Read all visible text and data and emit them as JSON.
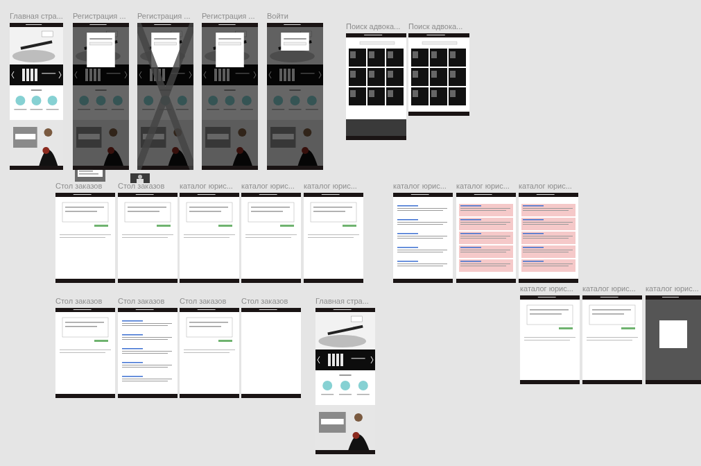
{
  "frames": [
    {
      "title": "Главная стра...",
      "kind": "home",
      "crossed": false
    },
    {
      "title": "Регистрация ...",
      "kind": "home_dialog",
      "crossed": false
    },
    {
      "title": "Регистрация ...",
      "kind": "home_dialog",
      "crossed": true
    },
    {
      "title": "Регистрация ...",
      "kind": "home_dialog",
      "crossed": false
    },
    {
      "title": "Войти",
      "kind": "home_dialog",
      "crossed": false
    },
    {
      "title": "Поиск адвока...",
      "kind": "search",
      "crossed": false
    },
    {
      "title": "Поиск адвока...",
      "kind": "search",
      "crossed": false
    },
    {
      "title": "Стол заказов",
      "kind": "form",
      "crossed": false
    },
    {
      "title": "Стол заказов",
      "kind": "form",
      "crossed": false
    },
    {
      "title": "каталог юрис...",
      "kind": "form",
      "crossed": false
    },
    {
      "title": "каталог юрис...",
      "kind": "form",
      "crossed": false
    },
    {
      "title": "каталог юрис...",
      "kind": "form",
      "crossed": false
    },
    {
      "title": "каталог юрис...",
      "kind": "list",
      "crossed": false
    },
    {
      "title": "каталог юрис...",
      "kind": "list_pink",
      "crossed": false
    },
    {
      "title": "каталог юрис...",
      "kind": "list_pink",
      "crossed": false
    },
    {
      "title": "каталог юрис...",
      "kind": "form",
      "crossed": false
    },
    {
      "title": "каталог юрис...",
      "kind": "form",
      "crossed": false
    },
    {
      "title": "каталог юрис...",
      "kind": "modal",
      "crossed": false
    },
    {
      "title": "Стол заказов",
      "kind": "form",
      "crossed": false
    },
    {
      "title": "Стол заказов",
      "kind": "list",
      "crossed": false
    },
    {
      "title": "Стол заказов",
      "kind": "form",
      "crossed": false
    },
    {
      "title": "Стол заказов",
      "kind": "blank",
      "crossed": false
    },
    {
      "title": "Главная стра...",
      "kind": "home",
      "crossed": false
    }
  ]
}
